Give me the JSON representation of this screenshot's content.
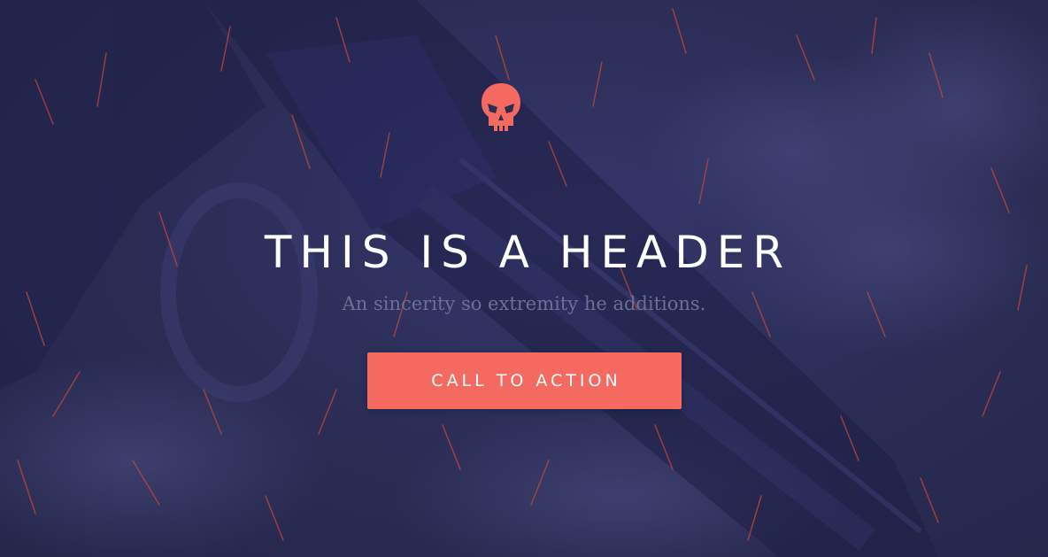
{
  "hero": {
    "headline": "THIS IS A HEADER",
    "subheadline": "An sincerity so extremity he additions.",
    "cta_label": "CALL TO ACTION",
    "logo_icon": "skull-icon"
  },
  "colors": {
    "background": "#2c2d55",
    "accent": "#f56a60",
    "headline": "#ffffff",
    "subheadline": "#6f6f95"
  }
}
